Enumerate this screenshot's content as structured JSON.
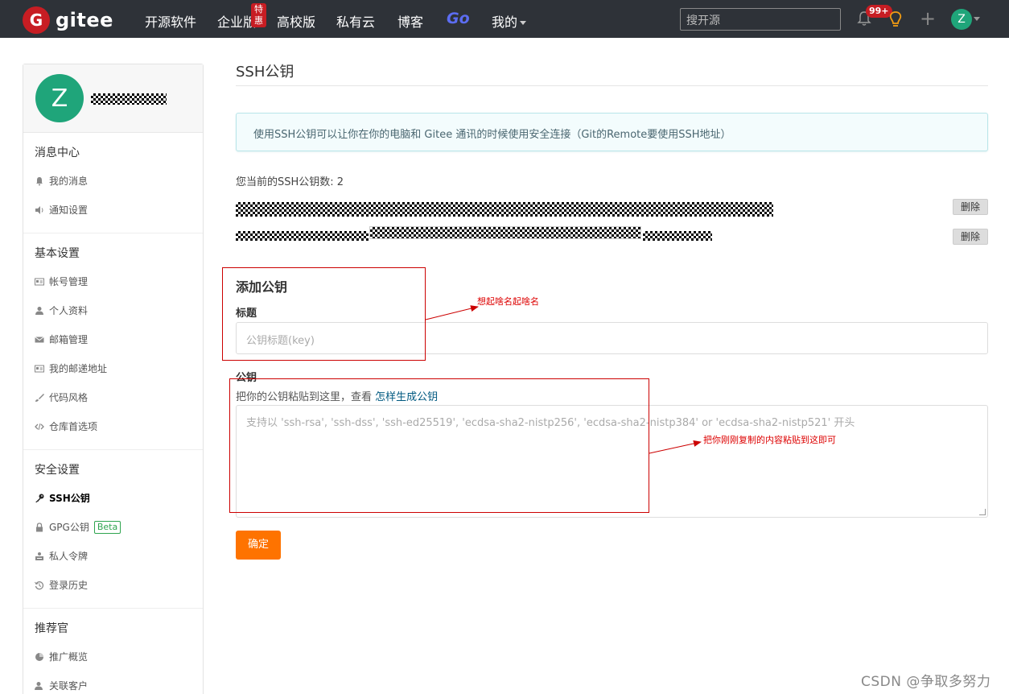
{
  "brand": {
    "logo_letter": "G",
    "name": "gitee"
  },
  "nav": {
    "items": [
      "开源软件",
      "企业版",
      "高校版",
      "私有云",
      "博客",
      "Go",
      "我的"
    ],
    "badge": "特惠",
    "search_placeholder": "搜开源",
    "notifications": "99+",
    "user_initial": "Z"
  },
  "sidebar": {
    "avatar_initial": "Z",
    "sections": [
      {
        "title": "消息中心",
        "items": [
          {
            "icon": "bell-icon",
            "label": "我的消息"
          },
          {
            "icon": "speaker-icon",
            "label": "通知设置"
          }
        ]
      },
      {
        "title": "基本设置",
        "items": [
          {
            "icon": "id-card-icon",
            "label": "帐号管理"
          },
          {
            "icon": "user-icon",
            "label": "个人资料"
          },
          {
            "icon": "mail-icon",
            "label": "邮箱管理"
          },
          {
            "icon": "id-card-icon",
            "label": "我的邮递地址"
          },
          {
            "icon": "brush-icon",
            "label": "代码风格"
          },
          {
            "icon": "code-icon",
            "label": "仓库首选项"
          }
        ]
      },
      {
        "title": "安全设置",
        "items": [
          {
            "icon": "key-icon",
            "label": "SSH公钥",
            "active": true
          },
          {
            "icon": "lock-icon",
            "label": "GPG公钥",
            "badge": "Beta"
          },
          {
            "icon": "token-icon",
            "label": "私人令牌"
          },
          {
            "icon": "history-icon",
            "label": "登录历史"
          }
        ]
      },
      {
        "title": "推荐官",
        "items": [
          {
            "icon": "chart-icon",
            "label": "推广概览"
          },
          {
            "icon": "user-link-icon",
            "label": "关联客户"
          }
        ]
      }
    ]
  },
  "main": {
    "title": "SSH公钥",
    "info": "使用SSH公钥可以让你在你的电脑和 Gitee 通讯的时候使用安全连接（Git的Remote要使用SSH地址）",
    "key_count_label": "您当前的SSH公钥数: 2",
    "delete_label": "删除",
    "add_title": "添加公钥",
    "field_title_label": "标题",
    "field_title_placeholder": "公钥标题(key)",
    "field_key_label": "公钥",
    "field_key_help": "把你的公钥粘贴到这里，查看",
    "field_key_help_link": "怎样生成公钥",
    "field_key_placeholder": "支持以 'ssh-rsa', 'ssh-dss', 'ssh-ed25519', 'ecdsa-sha2-nistp256', 'ecdsa-sha2-nistp384' or 'ecdsa-sha2-nistp521' 开头",
    "submit_label": "确定"
  },
  "annotations": {
    "note1": "想起啥名起啥名",
    "note2": "把你刚刚复制的内容粘贴到这即可",
    "color": "#cc0000"
  },
  "watermark": "CSDN @争取多努力",
  "colors": {
    "accent": "#fe7300",
    "header": "#2e3238",
    "avatar": "#1fa57a",
    "brand": "#c71d23"
  }
}
